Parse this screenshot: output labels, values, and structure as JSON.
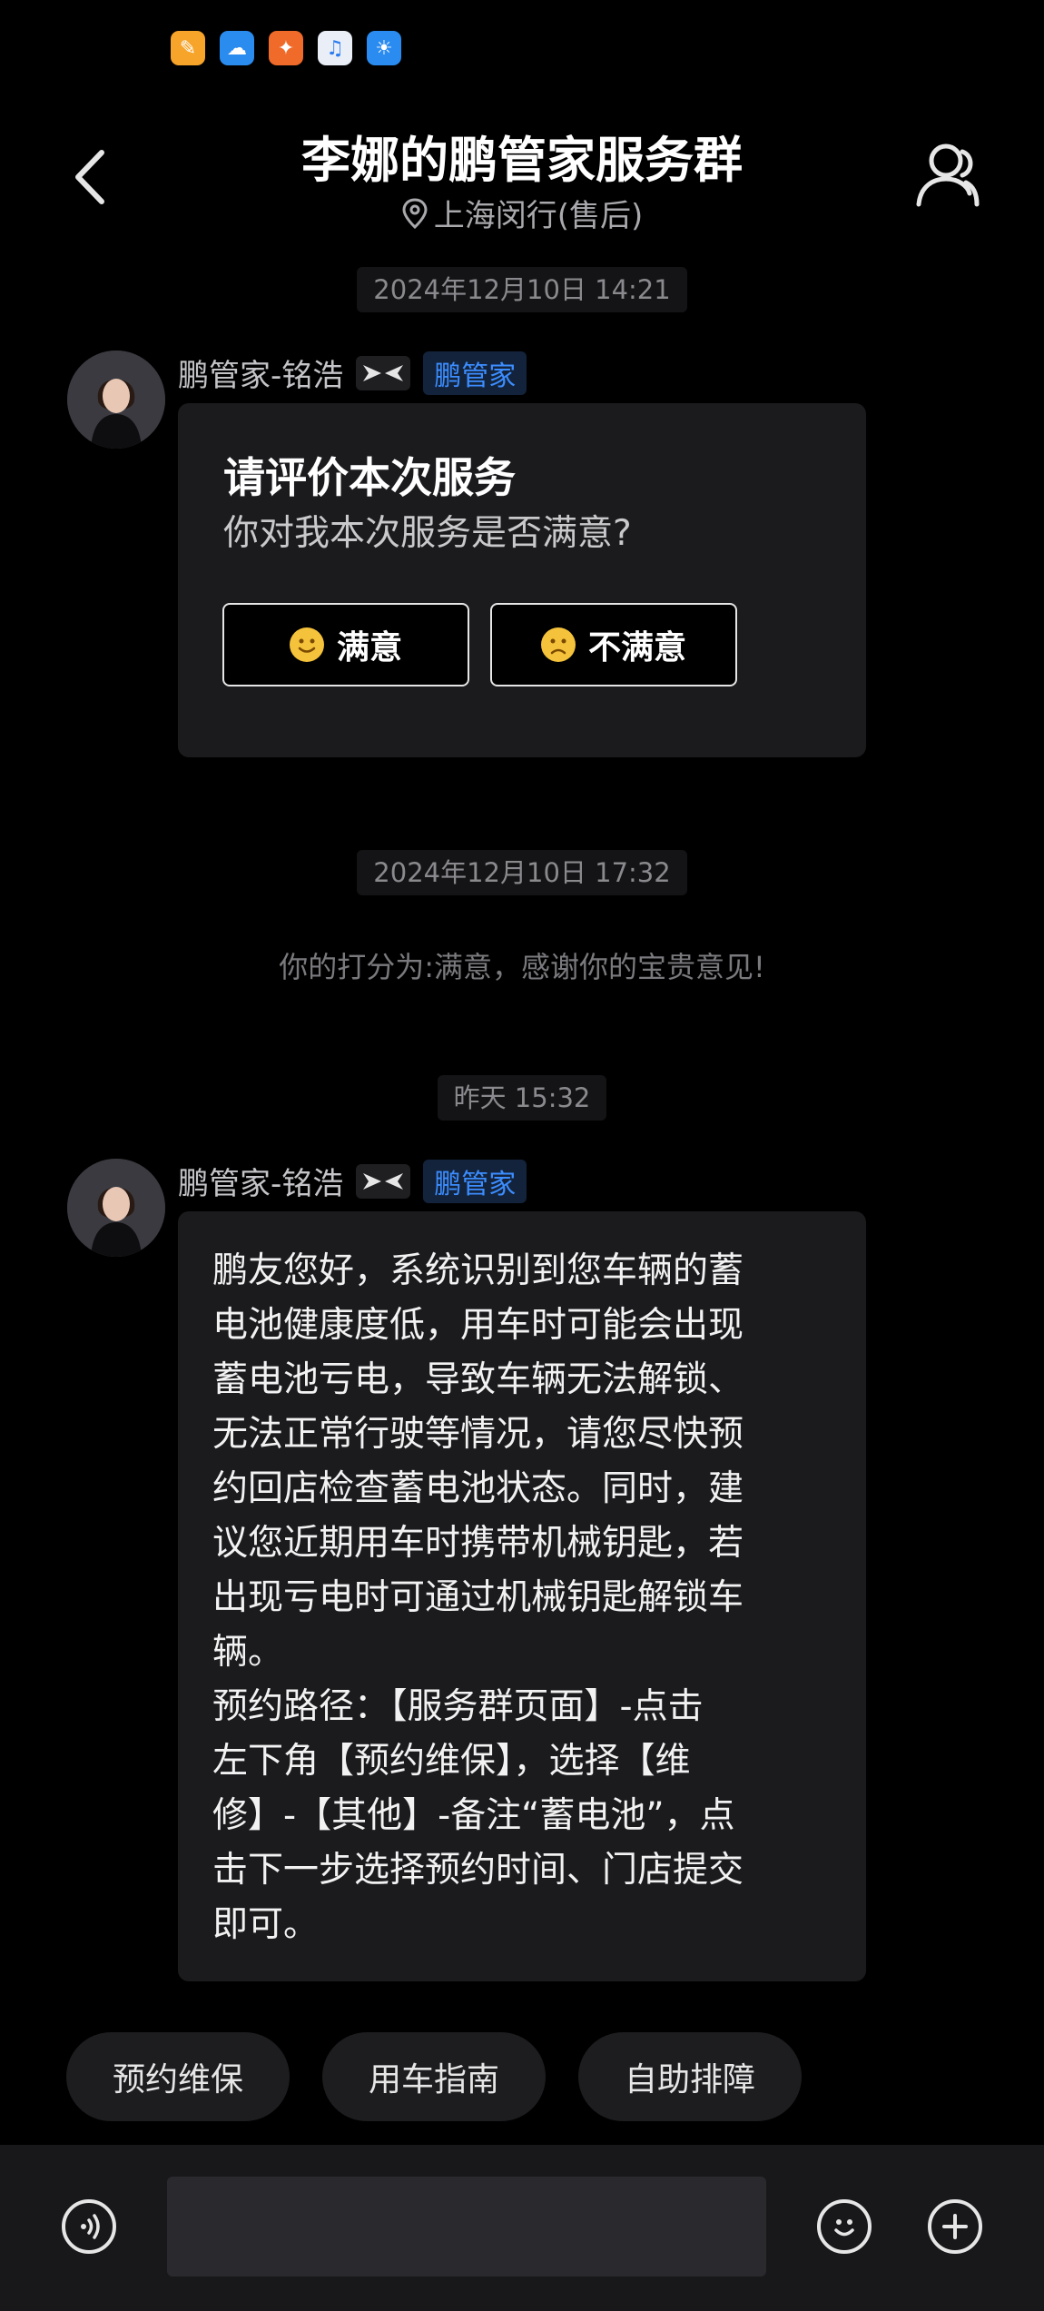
{
  "status_bar": {
    "app_icons": [
      "yellow-app-icon",
      "cloud-app-icon",
      "gift-app-icon",
      "music-app-icon",
      "weather-app-icon"
    ]
  },
  "header": {
    "title": "李娜的鹏管家服务群",
    "location": "上海闵行(售后)"
  },
  "messages": {
    "ts1": "2024年12月10日 14:21",
    "sender1": "鹏管家-铭浩",
    "badge1": "鹏管家",
    "card": {
      "title": "请评价本次服务",
      "subtitle": "你对我本次服务是否满意?",
      "satisfied_label": "满意",
      "unsatisfied_label": "不满意"
    },
    "ts2": "2024年12月10日 17:32",
    "system_msg": "你的打分为:满意，感谢你的宝贵意见!",
    "ts3": "昨天 15:32",
    "sender2": "鹏管家-铭浩",
    "badge2": "鹏管家",
    "text_message": "鹏友您好，系统识别到您车辆的蓄\n电池健康度低，用车时可能会出现\n蓄电池亏电，导致车辆无法解锁、\n无法正常行驶等情况，请您尽快预\n约回店检查蓄电池状态。同时，建\n议您近期用车时携带机械钥匙，若\n出现亏电时可通过机械钥匙解锁车\n辆。\n预约路径：【服务群页面】-点击\n左下角【预约维保】，选择【维\n修】-【其他】-备注“蓄电池”，点\n击下一步选择预约时间、门店提交\n即可。"
  },
  "quick_actions": [
    "预约维保",
    "用车指南",
    "自助排障"
  ],
  "input": {
    "placeholder": ""
  },
  "colors": {
    "accent_blue": "#3c8dff",
    "background": "#000000",
    "bubble": "#1b1b1e"
  }
}
